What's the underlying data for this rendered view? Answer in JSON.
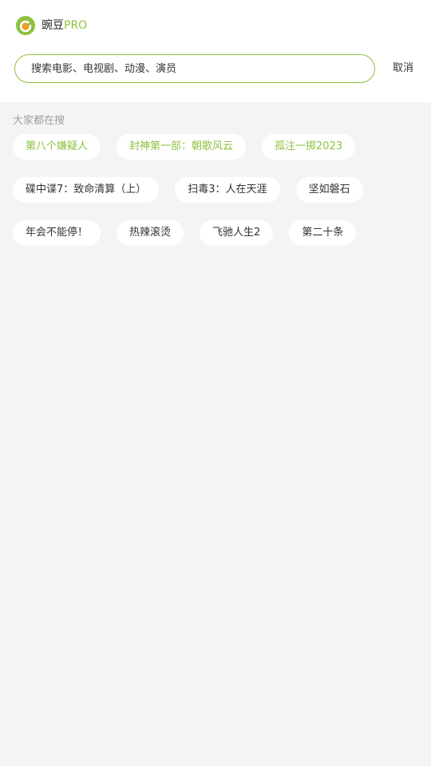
{
  "brand": {
    "name_main": "豌豆",
    "name_accent": "PRO",
    "accent_color": "#8dc13f"
  },
  "search": {
    "placeholder": "搜索电影、电视剧、动漫、演员",
    "value": "",
    "cancel_label": "取消"
  },
  "hot": {
    "title": "大家都在搜",
    "tags": [
      {
        "label": "第八个嫌疑人",
        "highlight": true
      },
      {
        "label": "封神第一部：朝歌风云",
        "highlight": true
      },
      {
        "label": "孤注一掷2023",
        "highlight": true
      },
      {
        "label": "碟中谍7：致命清算（上）",
        "highlight": false
      },
      {
        "label": "扫毒3：人在天涯",
        "highlight": false
      },
      {
        "label": "坚如磐石",
        "highlight": false
      },
      {
        "label": "年会不能停！",
        "highlight": false
      },
      {
        "label": "热辣滚烫",
        "highlight": false
      },
      {
        "label": "飞驰人生2",
        "highlight": false
      },
      {
        "label": "第二十条",
        "highlight": false
      }
    ]
  },
  "icons": {
    "logo": "app-logo-icon"
  }
}
